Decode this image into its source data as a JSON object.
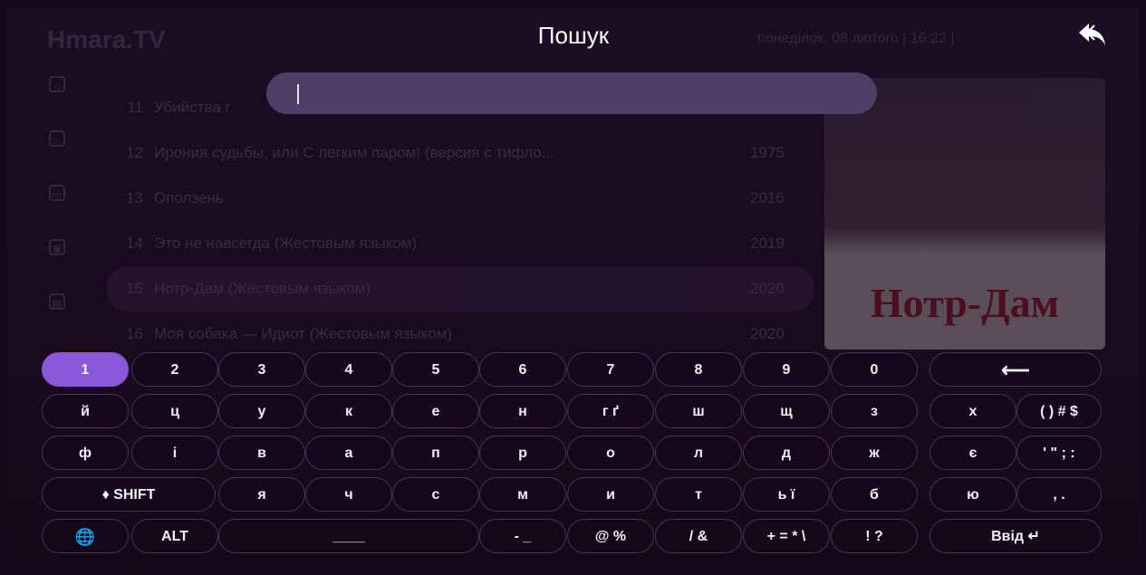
{
  "app": {
    "brand": "Hmara.TV",
    "datetime": "понеділок, 08 лютого | 16:22 |"
  },
  "header": {
    "title": "Пошук"
  },
  "search": {
    "value": ""
  },
  "list": [
    {
      "num": "11",
      "title": "Убийства г",
      "year": ""
    },
    {
      "num": "12",
      "title": "Ирония судьбы, или С легким паром! (версия с тифло...",
      "year": "1975"
    },
    {
      "num": "13",
      "title": "Оползень",
      "year": "2016"
    },
    {
      "num": "14",
      "title": "Это не навсегда (Жестовым языком)",
      "year": "2019"
    },
    {
      "num": "15",
      "title": "Нотр-Дам (Жестовым языком)",
      "year": "2020"
    },
    {
      "num": "16",
      "title": "Моя собака — Идиот (Жестовым языком)",
      "year": "2020"
    }
  ],
  "poster": {
    "title_text": "Нотр-Дам"
  },
  "keyboard": {
    "row1": [
      "1",
      "2",
      "3",
      "4",
      "5",
      "6",
      "7",
      "8",
      "9",
      "0",
      "⟵"
    ],
    "row2": [
      "й",
      "ц",
      "у",
      "к",
      "е",
      "н",
      "г ґ",
      "ш",
      "щ",
      "з",
      "х",
      "( ) # $"
    ],
    "row3": [
      "ф",
      "і",
      "в",
      "а",
      "п",
      "р",
      "о",
      "л",
      "д",
      "ж",
      "є",
      "' \" ; :"
    ],
    "row4": [
      "♦ SHIFT",
      "я",
      "ч",
      "с",
      "м",
      "и",
      "т",
      "ь ї",
      "б",
      "ю",
      ", ."
    ],
    "row5": [
      "🌐",
      "ALT",
      "____",
      "- _",
      "@ %",
      "/ &",
      "+ = * \\",
      "! ?",
      "Ввід ↵"
    ]
  },
  "colors": {
    "active_key": "#8a57d9",
    "search_bg": "#4f3f66",
    "poster_title": "#b21d22"
  }
}
